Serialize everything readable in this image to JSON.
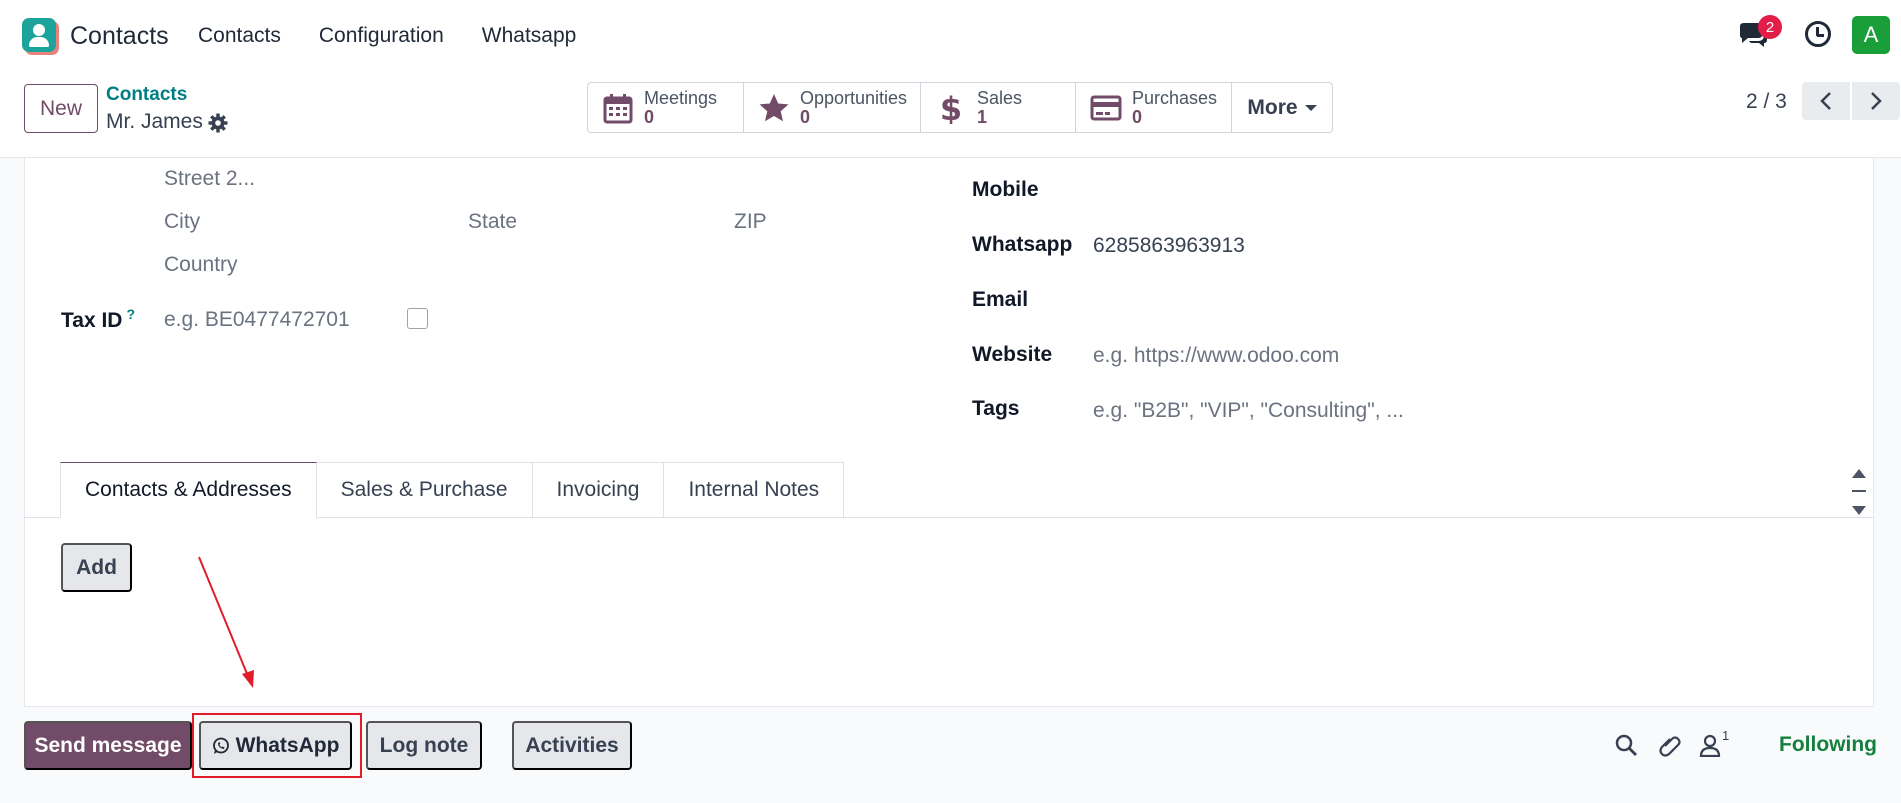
{
  "navbar": {
    "app_name": "Contacts",
    "menu": [
      "Contacts",
      "Configuration",
      "Whatsapp"
    ],
    "chat_badge": "2",
    "avatar_initial": "A"
  },
  "control": {
    "new_label": "New",
    "breadcrumb": "Contacts",
    "record_name": "Mr. James",
    "stats": [
      {
        "label": "Meetings",
        "value": "0",
        "icon": "calendar-icon"
      },
      {
        "label": "Opportunities",
        "value": "0",
        "icon": "star-icon"
      },
      {
        "label": "Sales",
        "value": "1",
        "icon": "dollar-icon"
      },
      {
        "label": "Purchases",
        "value": "0",
        "icon": "credit-card-icon"
      }
    ],
    "more_label": "More",
    "pager": "2 / 3"
  },
  "form": {
    "street2_ph": "Street 2...",
    "city_ph": "City",
    "state_ph": "State",
    "zip_ph": "ZIP",
    "country_ph": "Country",
    "tax_id_label": "Tax ID",
    "tax_id_help": "?",
    "tax_id_ph": "e.g. BE0477472701",
    "mobile_label": "Mobile",
    "whatsapp_label": "Whatsapp",
    "whatsapp_value": "6285863963913",
    "email_label": "Email",
    "website_label": "Website",
    "website_ph": "e.g. https://www.odoo.com",
    "tags_label": "Tags",
    "tags_ph": "e.g. \"B2B\", \"VIP\", \"Consulting\", ..."
  },
  "tabs": [
    "Contacts & Addresses",
    "Sales & Purchase",
    "Invoicing",
    "Internal Notes"
  ],
  "add_label": "Add",
  "chatter": {
    "send_message": "Send message",
    "whatsapp": "WhatsApp",
    "log_note": "Log note",
    "activities": "Activities",
    "follower_count": "1",
    "following": "Following"
  },
  "colors": {
    "primary": "#714b67",
    "link": "#017e84",
    "following": "#15803d",
    "highlight": "#e11d2a"
  }
}
